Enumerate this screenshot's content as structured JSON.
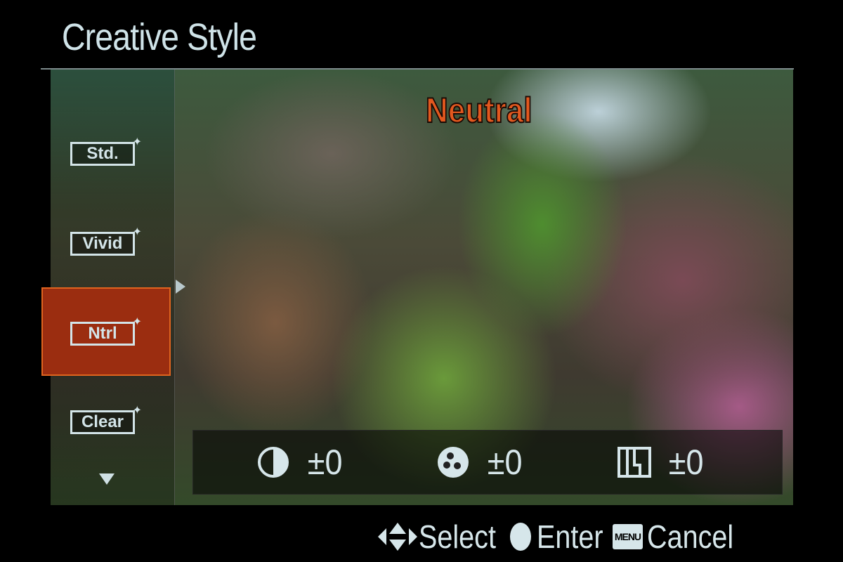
{
  "screen": {
    "title": "Creative Style",
    "selected_style_name": "Neutral"
  },
  "style_list": {
    "items": [
      {
        "label": "Std.",
        "selected": false
      },
      {
        "label": "Vivid",
        "selected": false
      },
      {
        "label": "Ntrl",
        "selected": true
      },
      {
        "label": "Clear",
        "selected": false
      }
    ],
    "more_below_icon": "triangle-down",
    "expand_icon": "triangle-right"
  },
  "parameters": [
    {
      "name": "contrast",
      "icon": "contrast-icon",
      "value": "±0"
    },
    {
      "name": "saturation",
      "icon": "saturation-icon",
      "value": "±0"
    },
    {
      "name": "sharpness",
      "icon": "sharpness-icon",
      "value": "±0"
    }
  ],
  "footer": {
    "select_label": "Select",
    "enter_label": "Enter",
    "menu_badge": "MENU",
    "cancel_label": "Cancel"
  },
  "colors": {
    "accent": "#e2581f",
    "selected_bg": "#9b2d10",
    "text": "#d6e6ea"
  }
}
